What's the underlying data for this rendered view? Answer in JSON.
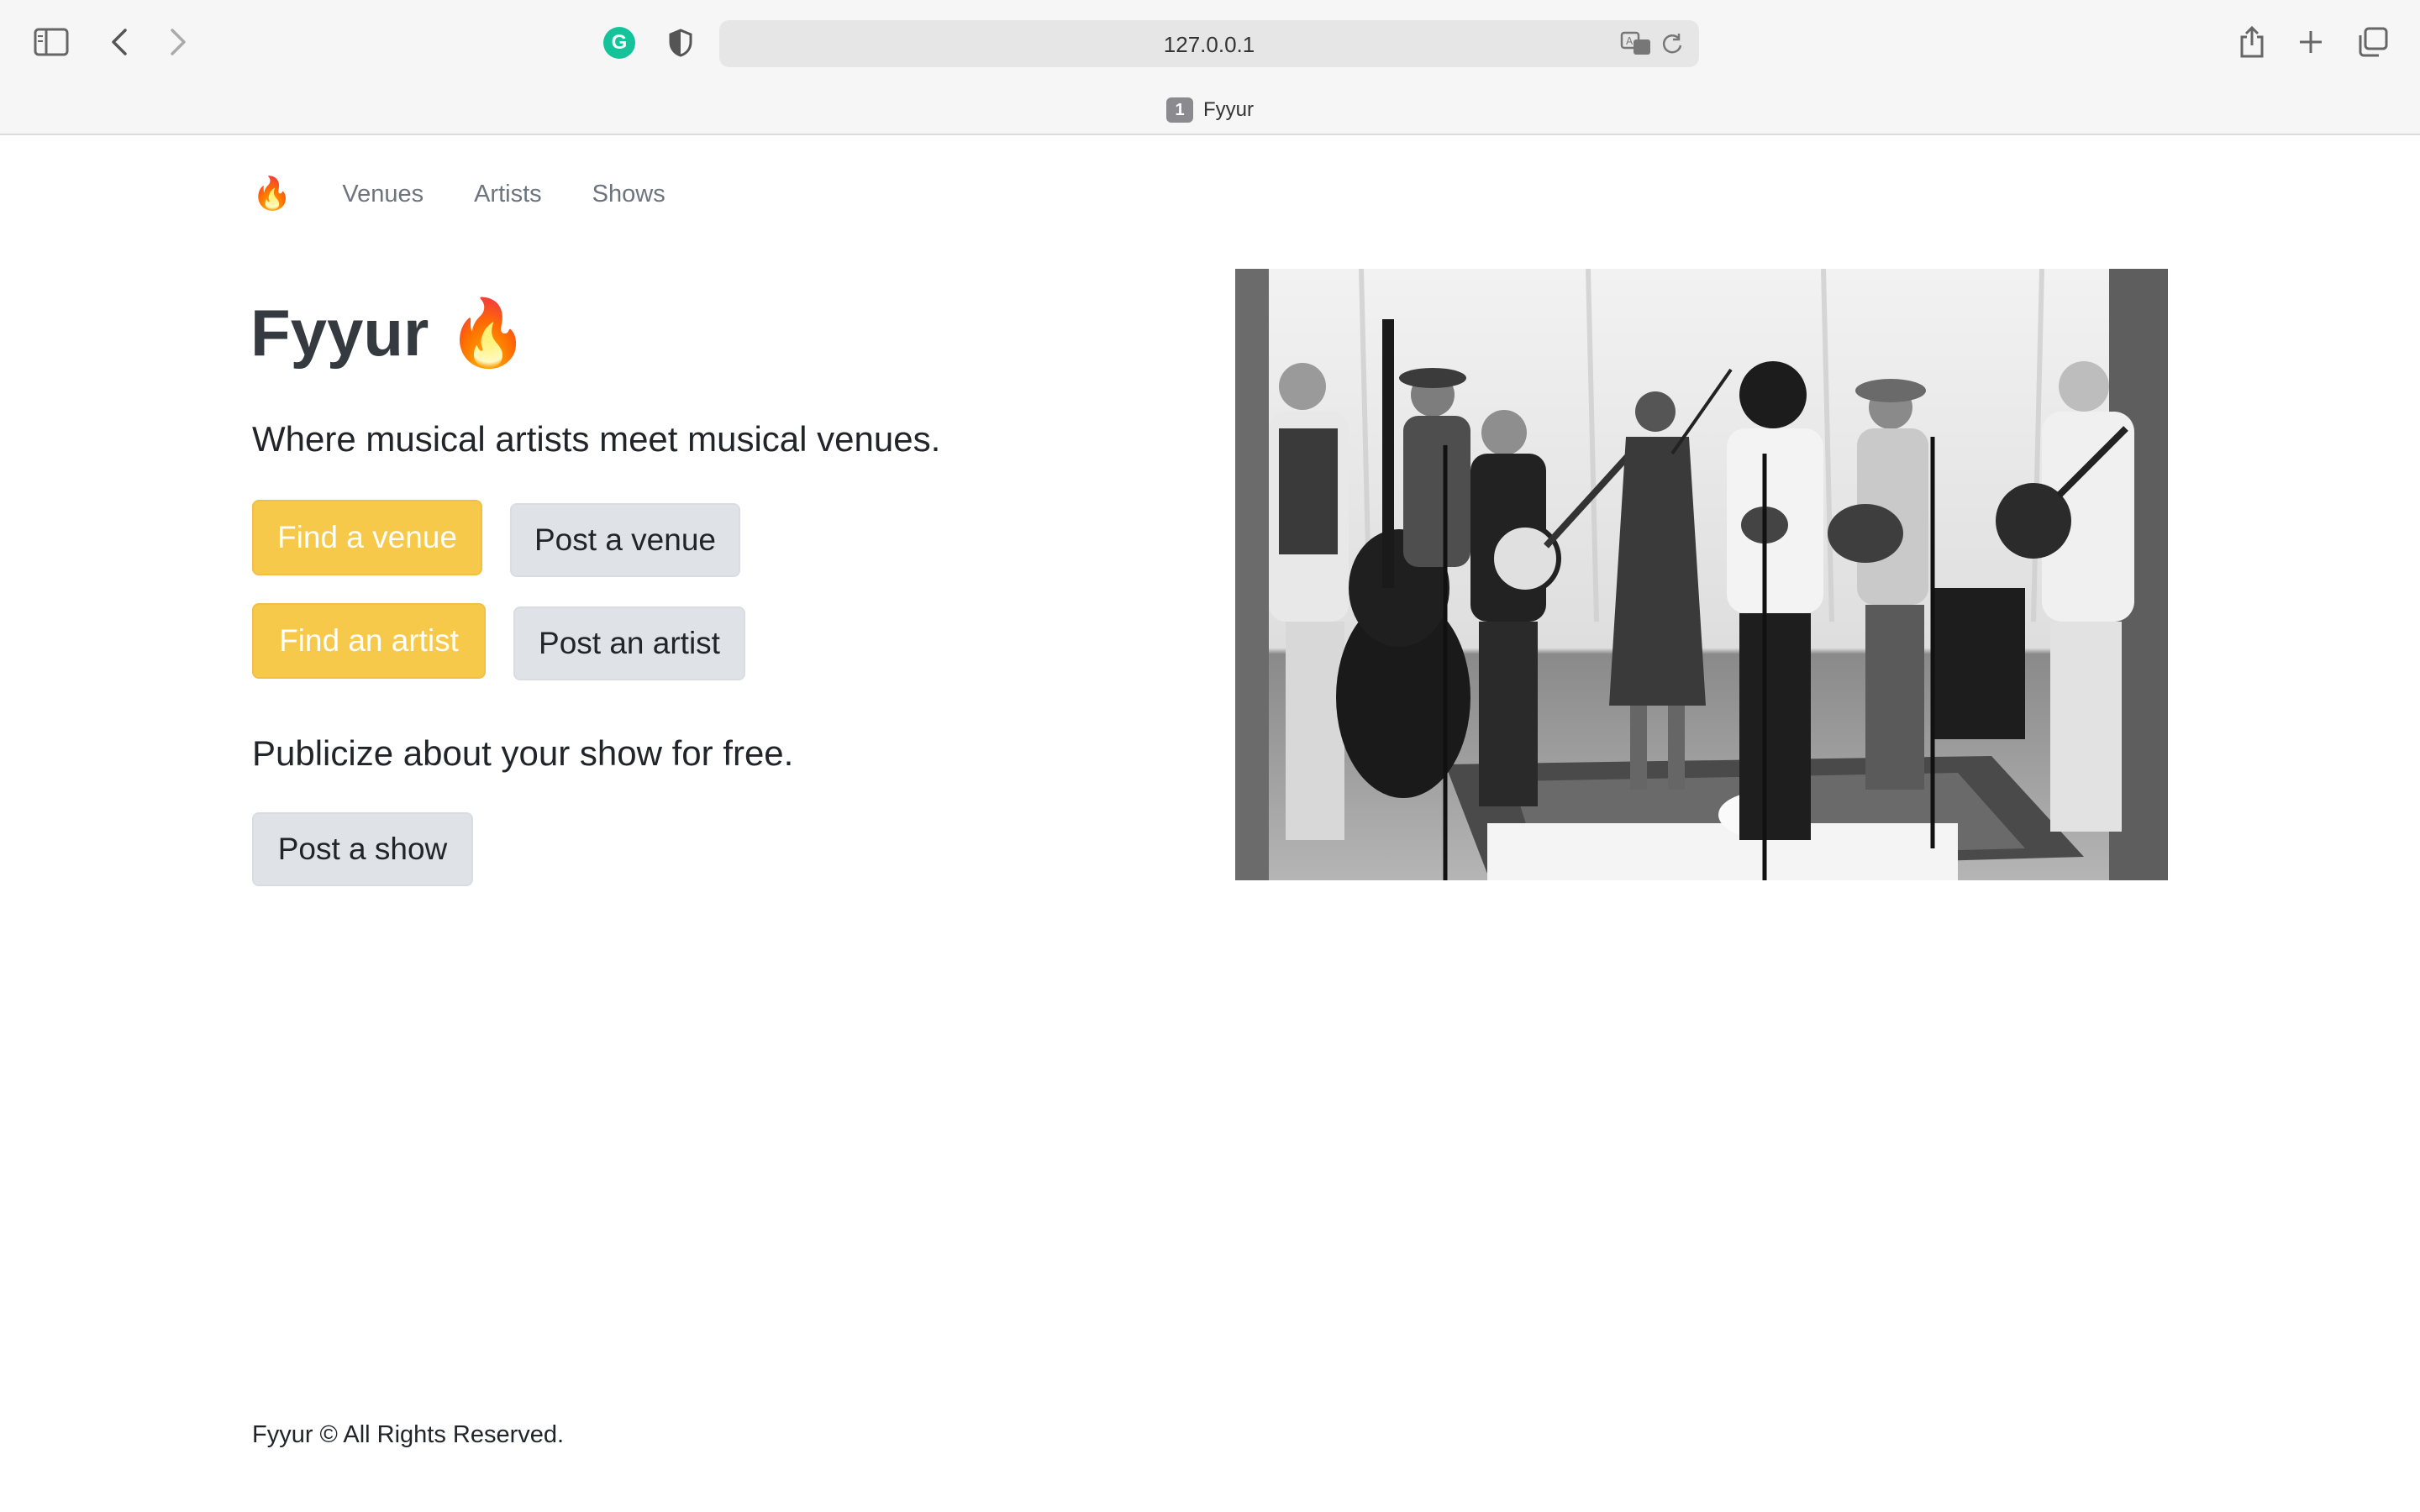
{
  "browser": {
    "url": "127.0.0.1",
    "tab_number": "1",
    "tab_title": "Fyyur",
    "extension_letter": "G"
  },
  "nav": {
    "brand_icon": "🔥",
    "links": [
      "Venues",
      "Artists",
      "Shows"
    ]
  },
  "hero": {
    "title": "Fyyur 🔥",
    "subtitle": "Where musical artists meet musical venues.",
    "find_venue": "Find a venue",
    "post_venue": "Post a venue",
    "find_artist": "Find an artist",
    "post_artist": "Post an artist",
    "publicize": "Publicize about your show for free.",
    "post_show": "Post a show"
  },
  "photo": {
    "description_icon": "band-photo"
  },
  "footer": {
    "text": "Fyyur © All Rights Reserved."
  },
  "colors": {
    "accent": "#f7c94a",
    "secondary_button": "#dfe2e6",
    "nav_link": "#6c757d",
    "grammarly": "#15c39a"
  }
}
